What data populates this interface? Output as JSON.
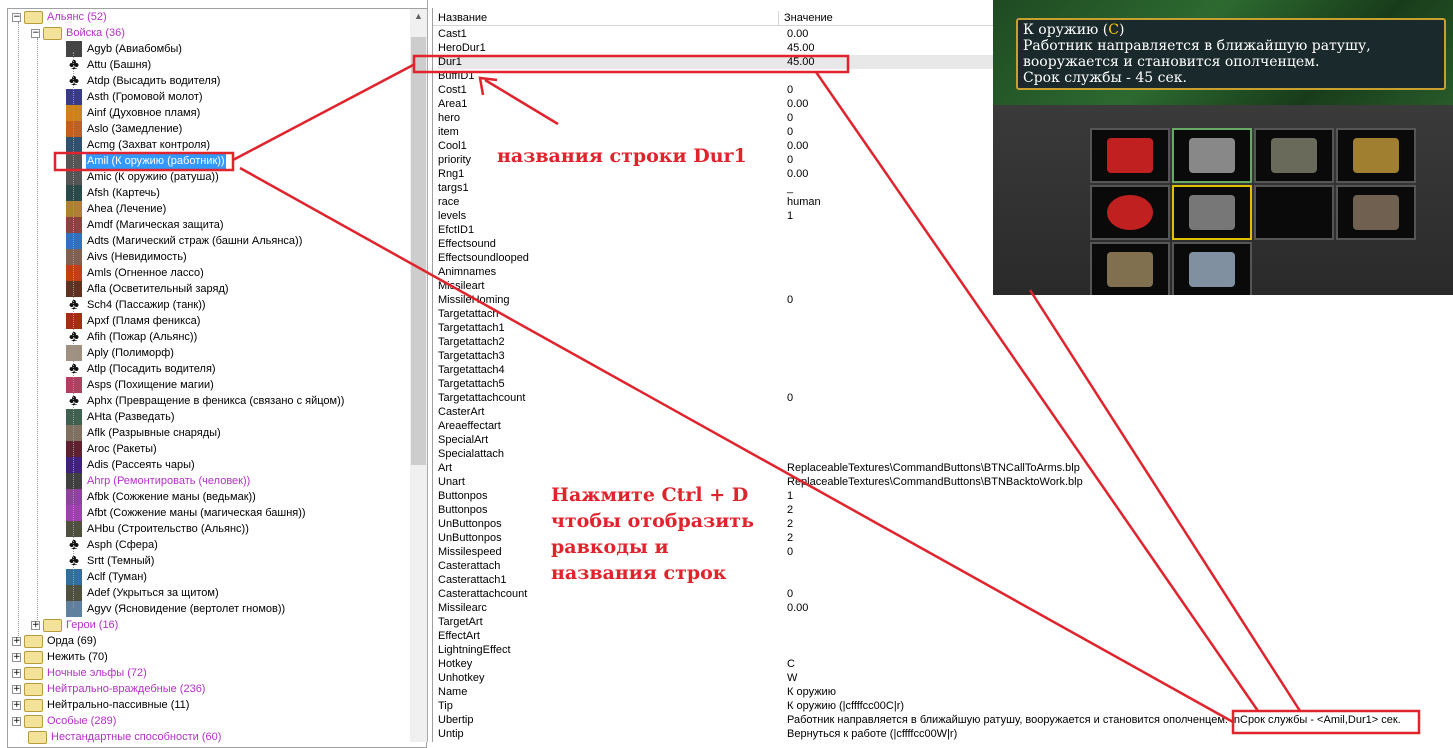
{
  "tree": [
    {
      "lvl": 0,
      "exp": "−",
      "folder": true,
      "label": "Альянс (52)",
      "purple": true
    },
    {
      "lvl": 1,
      "exp": "−",
      "folder": true,
      "label": "Войска (36)",
      "purple": true
    },
    {
      "lvl": 2,
      "icon": "#444",
      "label": "Agyb (Авиабомбы)"
    },
    {
      "lvl": 2,
      "icon": "key",
      "label": "Attu (Башня)"
    },
    {
      "lvl": 2,
      "icon": "key",
      "label": "Atdp (Высадить водителя)"
    },
    {
      "lvl": 2,
      "icon": "#3a3a8a",
      "label": "Asth (Громовой молот)"
    },
    {
      "lvl": 2,
      "icon": "#d08020",
      "label": "Ainf (Духовное пламя)"
    },
    {
      "lvl": 2,
      "icon": "#c06020",
      "label": "Aslo (Замедление)"
    },
    {
      "lvl": 2,
      "icon": "#305070",
      "label": "Acmg (Захват контроля)"
    },
    {
      "lvl": 2,
      "icon": "#555",
      "label": "Amil (К оружию (работник))",
      "selected": true
    },
    {
      "lvl": 2,
      "icon": "#555",
      "label": "Amic (К оружию (ратуша))"
    },
    {
      "lvl": 2,
      "icon": "#2a4a4a",
      "label": "Afsh (Картечь)"
    },
    {
      "lvl": 2,
      "icon": "#b08030",
      "label": "Ahea (Лечение)"
    },
    {
      "lvl": 2,
      "icon": "#904040",
      "label": "Amdf (Магическая защита)"
    },
    {
      "lvl": 2,
      "icon": "#3070c0",
      "label": "Adts (Магический страж (башни Альянса))"
    },
    {
      "lvl": 2,
      "icon": "#806050",
      "label": "Aivs (Невидимость)"
    },
    {
      "lvl": 2,
      "icon": "#c04010",
      "label": "Amls (Огненное лассо)"
    },
    {
      "lvl": 2,
      "icon": "#603020",
      "label": "Afla (Осветительный заряд)"
    },
    {
      "lvl": 2,
      "icon": "key",
      "label": "Sch4 (Пассажир (танк))"
    },
    {
      "lvl": 2,
      "icon": "#a03010",
      "label": "Apxf (Пламя феникса)"
    },
    {
      "lvl": 2,
      "icon": "key",
      "label": "Afih (Пожар (Альянс))"
    },
    {
      "lvl": 2,
      "icon": "#a09080",
      "label": "Aply (Полиморф)"
    },
    {
      "lvl": 2,
      "icon": "key",
      "label": "Atlp (Посадить водителя)"
    },
    {
      "lvl": 2,
      "icon": "#b04060",
      "label": "Asps (Похищение магии)"
    },
    {
      "lvl": 2,
      "icon": "key",
      "label": "Aphx (Превращение в феникса (связано с яйцом))"
    },
    {
      "lvl": 2,
      "icon": "#406050",
      "label": "AHta (Разведать)"
    },
    {
      "lvl": 2,
      "icon": "#807060",
      "label": "Aflk (Разрывные снаряды)"
    },
    {
      "lvl": 2,
      "icon": "#602030",
      "label": "Aroc (Ракеты)"
    },
    {
      "lvl": 2,
      "icon": "#402080",
      "label": "Adis (Рассеять чары)"
    },
    {
      "lvl": 2,
      "icon": "#404040",
      "label": "Ahrp (Ремонтировать (человек))",
      "purple": true
    },
    {
      "lvl": 2,
      "icon": "#9040a0",
      "label": "Afbk (Сожжение маны (ведьмак))"
    },
    {
      "lvl": 2,
      "icon": "#a040b0",
      "label": "Afbt (Сожжение маны (магическая башня))"
    },
    {
      "lvl": 2,
      "icon": "#505040",
      "label": "AHbu (Строительство (Альянс))"
    },
    {
      "lvl": 2,
      "icon": "key",
      "label": "Asph (Сфера)"
    },
    {
      "lvl": 2,
      "icon": "key",
      "label": "Srtt (Темный)"
    },
    {
      "lvl": 2,
      "icon": "#3070a0",
      "label": "Aclf (Туман)"
    },
    {
      "lvl": 2,
      "icon": "#505040",
      "label": "Adef (Укрыться за щитом)"
    },
    {
      "lvl": 2,
      "icon": "#6080a0",
      "label": "Agyv (Ясновидение (вертолет гномов))"
    },
    {
      "lvl": 1,
      "exp": "+",
      "folder": true,
      "label": "Герои (16)",
      "purple": true
    },
    {
      "lvl": 0,
      "exp": "+",
      "folder": true,
      "label": "Орда (69)"
    },
    {
      "lvl": 0,
      "exp": "+",
      "folder": true,
      "label": "Нежить (70)"
    },
    {
      "lvl": 0,
      "exp": "+",
      "folder": true,
      "label": "Ночные эльфы (72)",
      "purple": true
    },
    {
      "lvl": 0,
      "exp": "+",
      "folder": true,
      "label": "Нейтрально-враждебные (236)",
      "purple": true
    },
    {
      "lvl": 0,
      "exp": "+",
      "folder": true,
      "label": "Нейтрально-пассивные (11)"
    },
    {
      "lvl": 0,
      "exp": "+",
      "folder": true,
      "label": "Особые (289)",
      "purple": true
    },
    {
      "lvl": -1,
      "folder": true,
      "label": "Нестандартные способности (60)",
      "purple": true
    }
  ],
  "table": {
    "col_name": "Название",
    "col_value": "Значение",
    "rows": [
      [
        "Cast1",
        "0.00"
      ],
      [
        "HeroDur1",
        "45.00"
      ],
      [
        "Dur1",
        "45.00"
      ],
      [
        "BuffID1",
        ""
      ],
      [
        "Cost1",
        "0"
      ],
      [
        "Area1",
        "0.00"
      ],
      [
        "hero",
        "0"
      ],
      [
        "item",
        "0"
      ],
      [
        "Cool1",
        "0.00"
      ],
      [
        "priority",
        "0"
      ],
      [
        "Rng1",
        "0.00"
      ],
      [
        "targs1",
        "_"
      ],
      [
        "race",
        "human"
      ],
      [
        "levels",
        "1"
      ],
      [
        "EfctID1",
        ""
      ],
      [
        "Effectsound",
        ""
      ],
      [
        "Effectsoundlooped",
        ""
      ],
      [
        "Animnames",
        ""
      ],
      [
        "Missileart",
        ""
      ],
      [
        "MissileHoming",
        "0"
      ],
      [
        "Targetattach",
        ""
      ],
      [
        "Targetattach1",
        ""
      ],
      [
        "Targetattach2",
        ""
      ],
      [
        "Targetattach3",
        ""
      ],
      [
        "Targetattach4",
        ""
      ],
      [
        "Targetattach5",
        ""
      ],
      [
        "Targetattachcount",
        "0"
      ],
      [
        "CasterArt",
        ""
      ],
      [
        "Areaeffectart",
        ""
      ],
      [
        "SpecialArt",
        ""
      ],
      [
        "Specialattach",
        ""
      ],
      [
        "Art",
        "ReplaceableTextures\\CommandButtons\\BTNCallToArms.blp"
      ],
      [
        "Unart",
        "ReplaceableTextures\\CommandButtons\\BTNBacktoWork.blp"
      ],
      [
        "Buttonpos",
        "1"
      ],
      [
        "Buttonpos",
        "2"
      ],
      [
        "UnButtonpos",
        "2"
      ],
      [
        "UnButtonpos",
        "2"
      ],
      [
        "Missilespeed",
        "0"
      ],
      [
        "Casterattach",
        ""
      ],
      [
        "Casterattach1",
        ""
      ],
      [
        "Casterattachcount",
        "0"
      ],
      [
        "Missilearc",
        "0.00"
      ],
      [
        "TargetArt",
        ""
      ],
      [
        "EffectArt",
        ""
      ],
      [
        "LightningEffect",
        ""
      ],
      [
        "Hotkey",
        "C"
      ],
      [
        "Unhotkey",
        "W"
      ],
      [
        "Name",
        "К оружию"
      ],
      [
        "Tip",
        "К оружию (|cffffcc00C|r)"
      ],
      [
        "Ubertip",
        "Работник направляется в ближайшую ратушу, вооружается и становится ополченцем. |nСрок службы - <Amil,Dur1> сек."
      ],
      [
        "Untip",
        "Вернуться к работе (|cffffcc00W|r)"
      ]
    ],
    "highlight_row": 2
  },
  "game_tooltip": {
    "title": "К оружию (",
    "hotkey": "C",
    "title_end": ")",
    "line1": "Работник направляется в ближайшую ратушу,",
    "line2": "вооружается и становится ополченцем.",
    "line3": "Срок службы - 45 сек."
  },
  "annotations": {
    "note1": "названия строки Dur1",
    "note2": [
      "Нажмите Ctrl + D",
      "чтобы отобразить",
      "равкоды и",
      "названия строк"
    ]
  },
  "colors": {
    "accent": "#e0232c",
    "selection": "#3399ff",
    "purple": "#b530c8"
  }
}
